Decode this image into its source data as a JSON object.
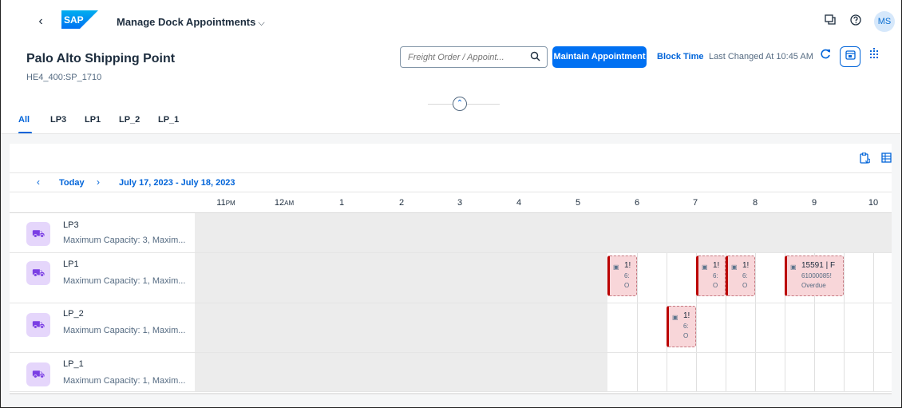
{
  "shell": {
    "back_glyph": "‹",
    "logo_text": "SAP",
    "app_title": "Manage Dock Appointments",
    "app_title_caret": "⌵",
    "avatar_initials": "MS",
    "icons": {
      "notifications": "notifications-icon",
      "help": "help-icon"
    }
  },
  "header": {
    "title": "Palo Alto Shipping Point",
    "subtitle": "HE4_400:SP_1710",
    "search_placeholder": "Freight Order / Appoint...",
    "search_icon": "🔍",
    "maintain_button": "Maintain Appointment",
    "block_time_link": "Block Time",
    "last_changed": "Last Changed At 10:45 AM",
    "collapse_glyph": "⌃"
  },
  "tabs": [
    {
      "label": "All",
      "active": true
    },
    {
      "label": "LP3"
    },
    {
      "label": "LP1"
    },
    {
      "label": "LP_2"
    },
    {
      "label": "LP_1"
    }
  ],
  "calendar": {
    "nav": {
      "prev": "‹",
      "today": "Today",
      "next": "›",
      "range": "July 17, 2023 - July 18, 2023"
    },
    "hours": [
      {
        "label": "11",
        "suffix": "PM"
      },
      {
        "label": "12",
        "suffix": "AM"
      },
      {
        "label": "1",
        "suffix": ""
      },
      {
        "label": "2",
        "suffix": ""
      },
      {
        "label": "3",
        "suffix": ""
      },
      {
        "label": "4",
        "suffix": ""
      },
      {
        "label": "5",
        "suffix": ""
      },
      {
        "label": "6",
        "suffix": ""
      },
      {
        "label": "7",
        "suffix": ""
      },
      {
        "label": "8",
        "suffix": ""
      },
      {
        "label": "9",
        "suffix": ""
      },
      {
        "label": "10",
        "suffix": ""
      }
    ],
    "rows": [
      {
        "name": "LP3",
        "description": "Maximum Capacity: 3, Maxim..."
      },
      {
        "name": "LP1",
        "description": "Maximum Capacity: 1, Maxim..."
      },
      {
        "name": "LP_2",
        "description": "Maximum Capacity: 1, Maxim..."
      },
      {
        "name": "LP_1",
        "description": "Maximum Capacity: 1, Maxim..."
      }
    ],
    "appointments": {
      "lp1_a": {
        "title": "1!",
        "text": "6:",
        "status": "O"
      },
      "lp1_b": {
        "title": "1!",
        "text": "6:",
        "status": "O"
      },
      "lp1_c": {
        "title": "1!",
        "text": "6:",
        "status": "O"
      },
      "lp1_d": {
        "title": "15591 | F",
        "text": "61000085!",
        "status": "Overdue"
      },
      "lp2_a": {
        "title": "1!",
        "text": "6:",
        "status": "O"
      }
    }
  },
  "colors": {
    "brand_blue": "#0070f2",
    "link_blue": "#0064d9",
    "overdue_red": "#bb0000",
    "appointment_fill": "#f8d6d9",
    "resource_icon_bg": "#e5d6fb"
  }
}
